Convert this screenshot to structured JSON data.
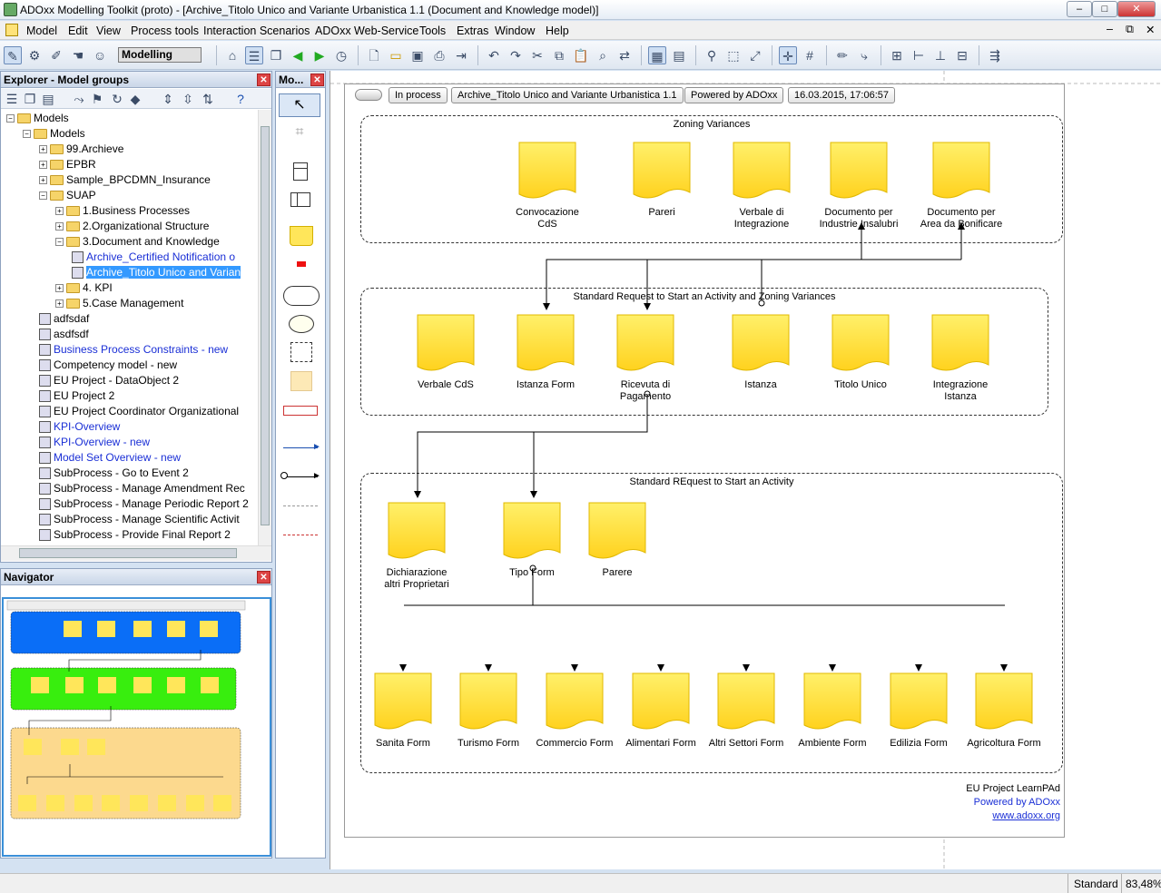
{
  "app": {
    "title": "ADOxx Modelling Toolkit (proto) - [Archive_Titolo Unico and Variante Urbanistica 1.1 (Document and Knowledge model)]",
    "window_controls": [
      "–",
      "□",
      "✕"
    ],
    "mdi_controls": [
      "–",
      "⧉",
      "✕"
    ]
  },
  "menu": [
    "Model",
    "Edit",
    "View",
    "Process tools",
    "Interaction Scenarios",
    "ADOxx Web-Service",
    "Tools",
    "Extras",
    "Window",
    "Help"
  ],
  "toolbar": {
    "mode": "Modelling"
  },
  "explorer": {
    "title": "Explorer - Model groups",
    "tree": [
      {
        "label": "Models",
        "kind": "folder",
        "level": 0,
        "expander": "−"
      },
      {
        "label": "Models",
        "kind": "folder",
        "level": 1,
        "expander": "−"
      },
      {
        "label": "99.Archieve",
        "kind": "folder",
        "level": 2,
        "expander": "+"
      },
      {
        "label": "EPBR",
        "kind": "folder",
        "level": 2,
        "expander": "+"
      },
      {
        "label": "Sample_BPCDMN_Insurance",
        "kind": "folder",
        "level": 2,
        "expander": "+"
      },
      {
        "label": "SUAP",
        "kind": "folder",
        "level": 2,
        "expander": "−"
      },
      {
        "label": "1.Business Processes",
        "kind": "folder",
        "level": 3,
        "expander": "+"
      },
      {
        "label": "2.Organizational Structure",
        "kind": "folder",
        "level": 3,
        "expander": "+"
      },
      {
        "label": "3.Document and Knowledge",
        "kind": "folder",
        "level": 3,
        "expander": "−"
      },
      {
        "label": "Archive_Certified Notification o",
        "kind": "model",
        "level": 4,
        "color": "blue"
      },
      {
        "label": "Archive_Titolo Unico and Varian",
        "kind": "model",
        "level": 4,
        "color": "selected"
      },
      {
        "label": "4. KPI",
        "kind": "folder",
        "level": 3,
        "expander": "+"
      },
      {
        "label": "5.Case Management",
        "kind": "folder",
        "level": 3,
        "expander": "+"
      },
      {
        "label": "adfsdaf",
        "kind": "model",
        "level": 2
      },
      {
        "label": "asdfsdf",
        "kind": "model",
        "level": 2
      },
      {
        "label": "Business Process Constraints - new",
        "kind": "model",
        "level": 2,
        "color": "blue"
      },
      {
        "label": "Competency model - new",
        "kind": "model",
        "level": 2
      },
      {
        "label": "EU Project - DataObject 2",
        "kind": "model",
        "level": 2
      },
      {
        "label": "EU Project 2",
        "kind": "model",
        "level": 2
      },
      {
        "label": "EU Project Coordinator Organizational",
        "kind": "model",
        "level": 2
      },
      {
        "label": "KPI-Overview",
        "kind": "model",
        "level": 2,
        "color": "blue"
      },
      {
        "label": "KPI-Overview - new",
        "kind": "model",
        "level": 2,
        "color": "blue"
      },
      {
        "label": "Model Set Overview - new",
        "kind": "model",
        "level": 2,
        "color": "blue"
      },
      {
        "label": "SubProcess - Go to Event 2",
        "kind": "model",
        "level": 2
      },
      {
        "label": "SubProcess - Manage Amendment Rec",
        "kind": "model",
        "level": 2
      },
      {
        "label": "SubProcess - Manage Periodic Report 2",
        "kind": "model",
        "level": 2
      },
      {
        "label": "SubProcess - Manage Scientific Activit",
        "kind": "model",
        "level": 2
      },
      {
        "label": "SubProcess - Provide Final Report 2",
        "kind": "model",
        "level": 2
      }
    ]
  },
  "navigator": {
    "title": "Navigator"
  },
  "palette": {
    "title": "Mo..."
  },
  "model": {
    "header": {
      "status": "In process",
      "name": "Archive_Titolo Unico and Variante Urbanistica 1.1",
      "powered": "Powered by ADOxx",
      "date": "16.03.2015, 17:06:57"
    },
    "lanes": [
      {
        "title": "Zoning Variances",
        "color": "#0a6ef7",
        "docs": [
          "Convocazione\nCdS",
          "Pareri",
          "Verbale di\nIntegrazione",
          "Documento per\nIndustrie Insalubri",
          "Documento per\nArea da Bonificare"
        ]
      },
      {
        "title": "Standard Request to Start an Activity and Zoning Variances",
        "color": "#38ee0e",
        "docs": [
          "Verbale CdS",
          "Istanza Form",
          "Ricevuta di\nPagamento",
          "Istanza",
          "Titolo Unico",
          "Integrazione\nIstanza"
        ]
      },
      {
        "title": "Standard REquest to Start an Activity",
        "color": "#fcd98e",
        "docs": [
          "Dichiarazione\naltri Proprietari",
          "Tipo Form",
          "Parere",
          "Sanita Form",
          "Turismo Form",
          "Commercio Form",
          "Alimentari Form",
          "Altri Settori Form",
          "Ambiente Form",
          "Edilizia Form",
          "Agricoltura Form"
        ]
      }
    ],
    "footer": {
      "project": "EU Project LearnPAd",
      "powered": "Powered by ADOxx",
      "url": "www.adoxx.org"
    }
  },
  "status": {
    "mode": "Standard",
    "zoom": "83,48%"
  }
}
